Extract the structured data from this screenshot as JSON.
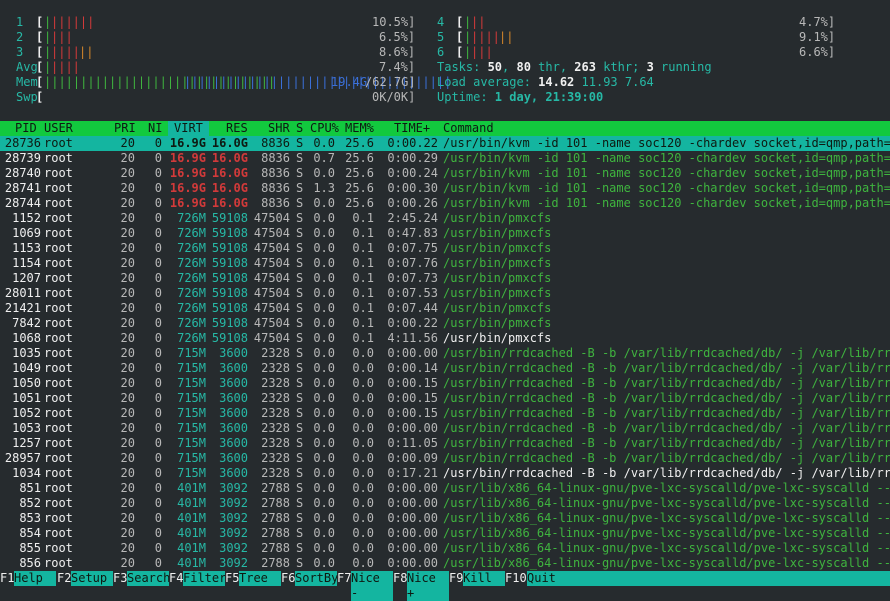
{
  "meters": {
    "cpu": [
      {
        "label": "1",
        "bar": "[",
        "ticks_green": "|",
        "ticks_red": "||||||",
        "ticks_other": "",
        "value": "10.5%]"
      },
      {
        "label": "2",
        "bar": "[",
        "ticks_green": "|",
        "ticks_red": "|||",
        "ticks_other": "",
        "value": "6.5%]"
      },
      {
        "label": "3",
        "bar": "[",
        "ticks_green": "|",
        "ticks_red": "||||",
        "ticks_other": "||",
        "value": "8.6%]"
      },
      {
        "label": "4",
        "bar": "[",
        "ticks_green": "|",
        "ticks_red": "||",
        "ticks_other": "",
        "value": "4.7%]"
      },
      {
        "label": "5",
        "bar": "[",
        "ticks_green": "|",
        "ticks_red": "||||",
        "ticks_other": "||",
        "value": "9.1%]"
      },
      {
        "label": "6",
        "bar": "[",
        "ticks_green": "|",
        "ticks_red": "|||",
        "ticks_other": "",
        "value": "6.6%]"
      }
    ],
    "avg": {
      "label": "Avg",
      "bar": "[",
      "ticks_green": "|",
      "ticks_red": "||||",
      "value": "7.4%]"
    },
    "mem": {
      "label": "Mem",
      "bar": "[",
      "ticks_green": "||||||||||||||||||||||||||||||||",
      "ticks_blue": "|||||||||||||||||||||||||||||||||||||",
      "used": "19.4G",
      "total": "/62.7G]"
    },
    "swp": {
      "label": "Swp",
      "bar": "[",
      "value": "0K/0K]"
    }
  },
  "tasks": {
    "label": "Tasks: ",
    "tasks": "50",
    "sep1": ", ",
    "thr": "80",
    "thr_label": " thr, ",
    "kthr": "263",
    "kthr_label": " kthr; ",
    "running": "3",
    "running_label": " running"
  },
  "load": {
    "label": "Load average: ",
    "l1": "14.62",
    "l5": "11.93",
    "l15": "7.64"
  },
  "uptime": {
    "label": "Uptime: ",
    "value": "1 day, 21:39:00"
  },
  "columns": [
    "PID",
    "USER",
    "PRI",
    "NI",
    "VIRT",
    "RES",
    "SHR",
    "S",
    "CPU%",
    "MEM%",
    "TIME+",
    "Command"
  ],
  "colors": {
    "header_bg": "#12c93e",
    "selection_bg": "#14b5a0",
    "background": "#262b2e",
    "cyan": "#26b9a6",
    "green": "#3fb43f",
    "red": "#d23a3a"
  },
  "processes": [
    {
      "pid": "28736",
      "user": "root",
      "pri": "20",
      "ni": "0",
      "virt": "16.9G",
      "res": "16.0G",
      "shr": "8836",
      "s": "S",
      "cpu": "0.0",
      "mem": "25.6",
      "time": "0:00.22",
      "cmd": "/usr/bin/kvm -id 101 -name soc120 -chardev socket,id=qmp,path=",
      "kind": "kvm",
      "selected": true
    },
    {
      "pid": "28739",
      "user": "root",
      "pri": "20",
      "ni": "0",
      "virt": "16.9G",
      "res": "16.0G",
      "shr": "8836",
      "s": "S",
      "cpu": "0.7",
      "mem": "25.6",
      "time": "0:00.29",
      "cmd": "/usr/bin/kvm -id 101 -name soc120 -chardev socket,id=qmp,path=",
      "kind": "kvm"
    },
    {
      "pid": "28740",
      "user": "root",
      "pri": "20",
      "ni": "0",
      "virt": "16.9G",
      "res": "16.0G",
      "shr": "8836",
      "s": "S",
      "cpu": "0.0",
      "mem": "25.6",
      "time": "0:00.24",
      "cmd": "/usr/bin/kvm -id 101 -name soc120 -chardev socket,id=qmp,path=",
      "kind": "kvm"
    },
    {
      "pid": "28741",
      "user": "root",
      "pri": "20",
      "ni": "0",
      "virt": "16.9G",
      "res": "16.0G",
      "shr": "8836",
      "s": "S",
      "cpu": "1.3",
      "mem": "25.6",
      "time": "0:00.30",
      "cmd": "/usr/bin/kvm -id 101 -name soc120 -chardev socket,id=qmp,path=",
      "kind": "kvm"
    },
    {
      "pid": "28744",
      "user": "root",
      "pri": "20",
      "ni": "0",
      "virt": "16.9G",
      "res": "16.0G",
      "shr": "8836",
      "s": "S",
      "cpu": "0.0",
      "mem": "25.6",
      "time": "0:00.26",
      "cmd": "/usr/bin/kvm -id 101 -name soc120 -chardev socket,id=qmp,path=",
      "kind": "kvm"
    },
    {
      "pid": "1152",
      "user": "root",
      "pri": "20",
      "ni": "0",
      "virt": "726M",
      "res": "59108",
      "shr": "47504",
      "s": "S",
      "cpu": "0.0",
      "mem": "0.1",
      "time": "2:45.24",
      "cmd": "/usr/bin/pmxcfs",
      "kind": "thread"
    },
    {
      "pid": "1069",
      "user": "root",
      "pri": "20",
      "ni": "0",
      "virt": "726M",
      "res": "59108",
      "shr": "47504",
      "s": "S",
      "cpu": "0.0",
      "mem": "0.1",
      "time": "0:47.83",
      "cmd": "/usr/bin/pmxcfs",
      "kind": "thread"
    },
    {
      "pid": "1153",
      "user": "root",
      "pri": "20",
      "ni": "0",
      "virt": "726M",
      "res": "59108",
      "shr": "47504",
      "s": "S",
      "cpu": "0.0",
      "mem": "0.1",
      "time": "0:07.75",
      "cmd": "/usr/bin/pmxcfs",
      "kind": "thread"
    },
    {
      "pid": "1154",
      "user": "root",
      "pri": "20",
      "ni": "0",
      "virt": "726M",
      "res": "59108",
      "shr": "47504",
      "s": "S",
      "cpu": "0.0",
      "mem": "0.1",
      "time": "0:07.76",
      "cmd": "/usr/bin/pmxcfs",
      "kind": "thread"
    },
    {
      "pid": "1207",
      "user": "root",
      "pri": "20",
      "ni": "0",
      "virt": "726M",
      "res": "59108",
      "shr": "47504",
      "s": "S",
      "cpu": "0.0",
      "mem": "0.1",
      "time": "0:07.73",
      "cmd": "/usr/bin/pmxcfs",
      "kind": "thread"
    },
    {
      "pid": "28011",
      "user": "root",
      "pri": "20",
      "ni": "0",
      "virt": "726M",
      "res": "59108",
      "shr": "47504",
      "s": "S",
      "cpu": "0.0",
      "mem": "0.1",
      "time": "0:07.53",
      "cmd": "/usr/bin/pmxcfs",
      "kind": "thread"
    },
    {
      "pid": "21421",
      "user": "root",
      "pri": "20",
      "ni": "0",
      "virt": "726M",
      "res": "59108",
      "shr": "47504",
      "s": "S",
      "cpu": "0.0",
      "mem": "0.1",
      "time": "0:07.44",
      "cmd": "/usr/bin/pmxcfs",
      "kind": "thread"
    },
    {
      "pid": "7842",
      "user": "root",
      "pri": "20",
      "ni": "0",
      "virt": "726M",
      "res": "59108",
      "shr": "47504",
      "s": "S",
      "cpu": "0.0",
      "mem": "0.1",
      "time": "0:00.22",
      "cmd": "/usr/bin/pmxcfs",
      "kind": "thread"
    },
    {
      "pid": "1068",
      "user": "root",
      "pri": "20",
      "ni": "0",
      "virt": "726M",
      "res": "59108",
      "shr": "47504",
      "s": "S",
      "cpu": "0.0",
      "mem": "0.1",
      "time": "4:11.56",
      "cmd": "/usr/bin/pmxcfs",
      "kind": "main"
    },
    {
      "pid": "1035",
      "user": "root",
      "pri": "20",
      "ni": "0",
      "virt": "715M",
      "res": "3600",
      "shr": "2328",
      "s": "S",
      "cpu": "0.0",
      "mem": "0.0",
      "time": "0:00.00",
      "cmd": "/usr/bin/rrdcached -B -b /var/lib/rrdcached/db/ -j /var/lib/rr",
      "kind": "thread"
    },
    {
      "pid": "1049",
      "user": "root",
      "pri": "20",
      "ni": "0",
      "virt": "715M",
      "res": "3600",
      "shr": "2328",
      "s": "S",
      "cpu": "0.0",
      "mem": "0.0",
      "time": "0:00.14",
      "cmd": "/usr/bin/rrdcached -B -b /var/lib/rrdcached/db/ -j /var/lib/rr",
      "kind": "thread"
    },
    {
      "pid": "1050",
      "user": "root",
      "pri": "20",
      "ni": "0",
      "virt": "715M",
      "res": "3600",
      "shr": "2328",
      "s": "S",
      "cpu": "0.0",
      "mem": "0.0",
      "time": "0:00.15",
      "cmd": "/usr/bin/rrdcached -B -b /var/lib/rrdcached/db/ -j /var/lib/rr",
      "kind": "thread"
    },
    {
      "pid": "1051",
      "user": "root",
      "pri": "20",
      "ni": "0",
      "virt": "715M",
      "res": "3600",
      "shr": "2328",
      "s": "S",
      "cpu": "0.0",
      "mem": "0.0",
      "time": "0:00.15",
      "cmd": "/usr/bin/rrdcached -B -b /var/lib/rrdcached/db/ -j /var/lib/rr",
      "kind": "thread"
    },
    {
      "pid": "1052",
      "user": "root",
      "pri": "20",
      "ni": "0",
      "virt": "715M",
      "res": "3600",
      "shr": "2328",
      "s": "S",
      "cpu": "0.0",
      "mem": "0.0",
      "time": "0:00.15",
      "cmd": "/usr/bin/rrdcached -B -b /var/lib/rrdcached/db/ -j /var/lib/rr",
      "kind": "thread"
    },
    {
      "pid": "1053",
      "user": "root",
      "pri": "20",
      "ni": "0",
      "virt": "715M",
      "res": "3600",
      "shr": "2328",
      "s": "S",
      "cpu": "0.0",
      "mem": "0.0",
      "time": "0:00.00",
      "cmd": "/usr/bin/rrdcached -B -b /var/lib/rrdcached/db/ -j /var/lib/rr",
      "kind": "thread"
    },
    {
      "pid": "1257",
      "user": "root",
      "pri": "20",
      "ni": "0",
      "virt": "715M",
      "res": "3600",
      "shr": "2328",
      "s": "S",
      "cpu": "0.0",
      "mem": "0.0",
      "time": "0:11.05",
      "cmd": "/usr/bin/rrdcached -B -b /var/lib/rrdcached/db/ -j /var/lib/rr",
      "kind": "thread"
    },
    {
      "pid": "28957",
      "user": "root",
      "pri": "20",
      "ni": "0",
      "virt": "715M",
      "res": "3600",
      "shr": "2328",
      "s": "S",
      "cpu": "0.0",
      "mem": "0.0",
      "time": "0:00.09",
      "cmd": "/usr/bin/rrdcached -B -b /var/lib/rrdcached/db/ -j /var/lib/rr",
      "kind": "thread"
    },
    {
      "pid": "1034",
      "user": "root",
      "pri": "20",
      "ni": "0",
      "virt": "715M",
      "res": "3600",
      "shr": "2328",
      "s": "S",
      "cpu": "0.0",
      "mem": "0.0",
      "time": "0:17.21",
      "cmd": "/usr/bin/rrdcached -B -b /var/lib/rrdcached/db/ -j /var/lib/rr",
      "kind": "main"
    },
    {
      "pid": "851",
      "user": "root",
      "pri": "20",
      "ni": "0",
      "virt": "401M",
      "res": "3092",
      "shr": "2788",
      "s": "S",
      "cpu": "0.0",
      "mem": "0.0",
      "time": "0:00.00",
      "cmd": "/usr/lib/x86_64-linux-gnu/pve-lxc-syscalld/pve-lxc-syscalld --",
      "kind": "thread"
    },
    {
      "pid": "852",
      "user": "root",
      "pri": "20",
      "ni": "0",
      "virt": "401M",
      "res": "3092",
      "shr": "2788",
      "s": "S",
      "cpu": "0.0",
      "mem": "0.0",
      "time": "0:00.00",
      "cmd": "/usr/lib/x86_64-linux-gnu/pve-lxc-syscalld/pve-lxc-syscalld --",
      "kind": "thread"
    },
    {
      "pid": "853",
      "user": "root",
      "pri": "20",
      "ni": "0",
      "virt": "401M",
      "res": "3092",
      "shr": "2788",
      "s": "S",
      "cpu": "0.0",
      "mem": "0.0",
      "time": "0:00.00",
      "cmd": "/usr/lib/x86_64-linux-gnu/pve-lxc-syscalld/pve-lxc-syscalld --",
      "kind": "thread"
    },
    {
      "pid": "854",
      "user": "root",
      "pri": "20",
      "ni": "0",
      "virt": "401M",
      "res": "3092",
      "shr": "2788",
      "s": "S",
      "cpu": "0.0",
      "mem": "0.0",
      "time": "0:00.00",
      "cmd": "/usr/lib/x86_64-linux-gnu/pve-lxc-syscalld/pve-lxc-syscalld --",
      "kind": "thread"
    },
    {
      "pid": "855",
      "user": "root",
      "pri": "20",
      "ni": "0",
      "virt": "401M",
      "res": "3092",
      "shr": "2788",
      "s": "S",
      "cpu": "0.0",
      "mem": "0.0",
      "time": "0:00.00",
      "cmd": "/usr/lib/x86_64-linux-gnu/pve-lxc-syscalld/pve-lxc-syscalld --",
      "kind": "thread"
    },
    {
      "pid": "856",
      "user": "root",
      "pri": "20",
      "ni": "0",
      "virt": "401M",
      "res": "3092",
      "shr": "2788",
      "s": "S",
      "cpu": "0.0",
      "mem": "0.0",
      "time": "0:00.00",
      "cmd": "/usr/lib/x86_64-linux-gnu/pve-lxc-syscalld/pve-lxc-syscalld --",
      "kind": "thread"
    }
  ],
  "footer": [
    {
      "key": "F1",
      "label": "Help"
    },
    {
      "key": "F2",
      "label": "Setup"
    },
    {
      "key": "F3",
      "label": "Search"
    },
    {
      "key": "F4",
      "label": "Filter"
    },
    {
      "key": "F5",
      "label": "Tree"
    },
    {
      "key": "F6",
      "label": "SortBy"
    },
    {
      "key": "F7",
      "label": "Nice -"
    },
    {
      "key": "F8",
      "label": "Nice +"
    },
    {
      "key": "F9",
      "label": "Kill"
    },
    {
      "key": "F10",
      "label": "Quit"
    }
  ]
}
